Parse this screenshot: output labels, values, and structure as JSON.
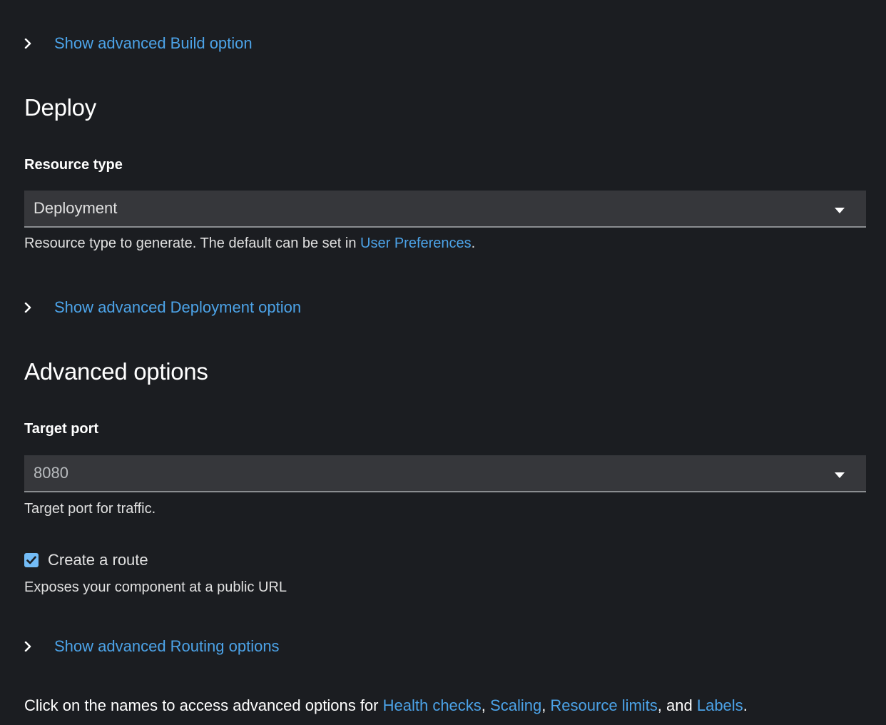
{
  "build": {
    "advanced_link": "Show advanced Build option"
  },
  "deploy": {
    "title": "Deploy",
    "resource_type": {
      "label": "Resource type",
      "selected": "Deployment",
      "helper_prefix": "Resource type to generate. The default can be set in ",
      "helper_link": "User Preferences",
      "helper_suffix": "."
    },
    "advanced_link": "Show advanced Deployment option"
  },
  "advanced": {
    "title": "Advanced options",
    "target_port": {
      "label": "Target port",
      "value": "8080",
      "helper": "Target port for traffic."
    },
    "create_route": {
      "label": "Create a route",
      "checked": true,
      "helper": "Exposes your component at a public URL"
    },
    "routing_link": "Show advanced Routing options",
    "footer": {
      "prefix": "Click on the names to access advanced options for ",
      "health_checks": "Health checks",
      "sep1": ", ",
      "scaling": "Scaling",
      "sep2": ", ",
      "resource_limits": "Resource limits",
      "sep3": ", and ",
      "labels": "Labels",
      "suffix": "."
    }
  },
  "icons": {
    "expander": "chevron-right-icon",
    "select_caret": "caret-down-icon",
    "checkbox": "check-icon"
  },
  "colors": {
    "background": "#1b1d21",
    "link": "#4ca3e8",
    "input_bg": "#36373b",
    "checkbox": "#73bcf7"
  }
}
